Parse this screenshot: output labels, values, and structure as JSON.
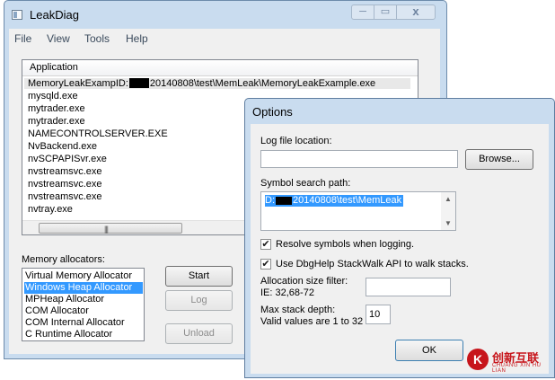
{
  "main_window": {
    "title": "LeakDiag",
    "caption_minimize": "─",
    "caption_maximize": "▭",
    "caption_close": "x"
  },
  "menu": [
    "File",
    "View",
    "Tools",
    "Help"
  ],
  "application_list": {
    "header": "Application",
    "selected_prefix": "MemoryLeakExampID:",
    "selected_suffix": "20140808\\test\\MemLeak\\MemoryLeakExample.exe",
    "items": [
      "mysqld.exe",
      "mytrader.exe",
      "mytrader.exe",
      "NAMECONTROLSERVER.EXE",
      "NvBackend.exe",
      "nvSCPAPISvr.exe",
      "nvstreamsvc.exe",
      "nvstreamsvc.exe",
      "nvstreamsvc.exe",
      "nvtray.exe"
    ],
    "hscroll_grip": "|||"
  },
  "memory_allocators": {
    "label": "Memory allocators:",
    "items": [
      "Virtual Memory Allocator",
      "Windows Heap Allocator",
      "MPHeap Allocator",
      "COM Allocator",
      "COM Internal Allocator",
      "C Runtime Allocator"
    ],
    "selected_index": 1
  },
  "main_buttons": {
    "start": "Start",
    "log": "Log",
    "unload": "Unload"
  },
  "options_dialog": {
    "title": "Options",
    "log_file_label": "Log file location:",
    "log_file_value": "",
    "browse_button": "Browse...",
    "symbol_path_label": "Symbol search path:",
    "symbol_path_prefix": "D:",
    "symbol_path_suffix": "20140808\\test\\MemLeak",
    "scroll_up": "▲",
    "scroll_down": "▼",
    "check_mark": "✔",
    "resolve_symbols_label": "Resolve symbols when logging.",
    "resolve_symbols_checked": true,
    "dbghelp_label": "Use DbgHelp StackWalk API to walk stacks.",
    "dbghelp_checked": true,
    "alloc_filter_label": "Allocation size filter:",
    "alloc_filter_hint": "IE: 32,68-72",
    "alloc_filter_value": "",
    "max_depth_label": "Max stack depth:",
    "max_depth_hint": "Valid values are 1 to 32",
    "max_depth_value": "10",
    "ok_button": "OK"
  },
  "watermark": {
    "logo_glyph": "K",
    "text_cn": "创新互联",
    "text_en": "CHUANG XIN HU LIAN"
  },
  "colors": {
    "frame": "#c9dcef",
    "selection": "#3399ff",
    "client": "#f0f0f0",
    "watermark": "#c7151b"
  }
}
